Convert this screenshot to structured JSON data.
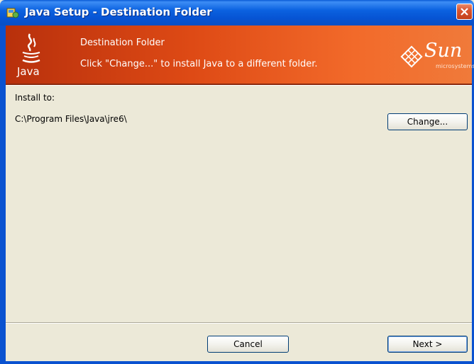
{
  "window": {
    "title": "Java Setup - Destination Folder",
    "title_icon": "installer-icon",
    "close_icon": "close-icon"
  },
  "banner": {
    "title": "Destination Folder",
    "description": "Click \"Change...\" to install Java to a different folder.",
    "java_logo_text": "Java",
    "sun_logo_text": "Sun",
    "sun_logo_subtext": "microsystems",
    "background_color": "#de4a15"
  },
  "content": {
    "install_label": "Install to:",
    "install_path": "C:\\Program Files\\Java\\jre6\\",
    "change_label": "Change..."
  },
  "footer": {
    "cancel_label": "Cancel",
    "next_label": "Next >"
  }
}
